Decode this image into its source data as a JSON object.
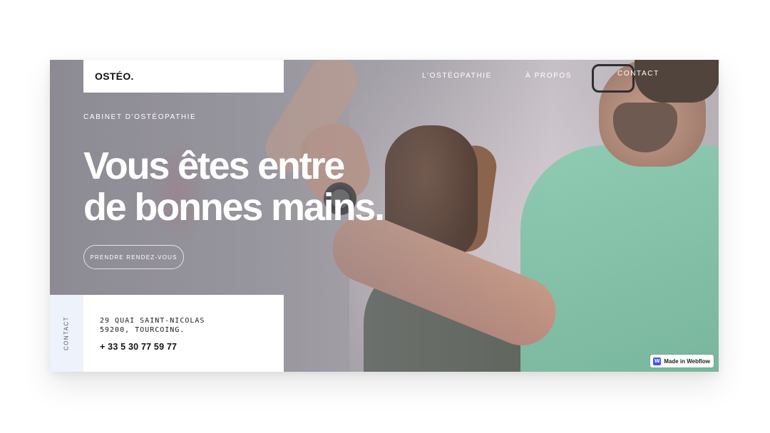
{
  "brand": {
    "logo": "OSTÉO."
  },
  "nav": {
    "items": [
      {
        "label": "L'OSTÉOPATHIE"
      },
      {
        "label": "À PROPOS"
      },
      {
        "label": "CONTACT"
      }
    ]
  },
  "hero": {
    "eyebrow": "CABINET D'OSTÉOPATHIE",
    "headline_line1": "Vous êtes entre",
    "headline_line2": "de bonnes mains.",
    "cta_label": "PRENDRE RENDEZ-VOUS"
  },
  "contact": {
    "side_label": "CONTACT",
    "address_line1": "29 QUAI SAINT-NICOLAS",
    "address_line2": "59200, TOURCOING.",
    "phone": "+ 33 5 30 77 59 77"
  },
  "badge": {
    "icon_letter": "W",
    "label": "Made in Webflow",
    "icon_color": "#4353ff"
  },
  "colors": {
    "contact_strip": "#eef2fb",
    "shirt": "#8fcfb4"
  }
}
